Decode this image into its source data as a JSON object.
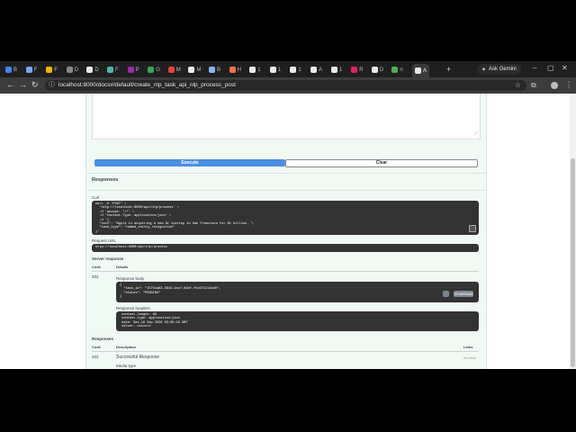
{
  "browser": {
    "tabs": [
      {
        "label": "B",
        "color": "#4285f4"
      },
      {
        "label": "F",
        "color": "#7aa7f7"
      },
      {
        "label": "F",
        "color": "#f4b400"
      },
      {
        "label": "D",
        "color": "#888888"
      },
      {
        "label": "D",
        "color": "#e8eaed"
      },
      {
        "label": "F",
        "color": "#4db6ac"
      },
      {
        "label": "P",
        "color": "#9c27b0"
      },
      {
        "label": "G",
        "color": "#34a853"
      },
      {
        "label": "M",
        "color": "#ea4335"
      },
      {
        "label": "M",
        "color": "#e8eaed"
      },
      {
        "label": "B",
        "color": "#8ab4f8"
      },
      {
        "label": "H",
        "color": "#ff7043"
      },
      {
        "label": "1",
        "color": "#e8eaed"
      },
      {
        "label": "1",
        "color": "#e8eaed"
      },
      {
        "label": "1",
        "color": "#e8eaed"
      },
      {
        "label": "A",
        "color": "#e8eaed"
      },
      {
        "label": "1",
        "color": "#e8eaed"
      },
      {
        "label": "R",
        "color": "#e91e63"
      },
      {
        "label": "D",
        "color": "#e8eaed"
      },
      {
        "label": "n",
        "color": "#4caf50"
      },
      {
        "label": "A",
        "color": "#e8eaed"
      }
    ],
    "new_tab": "+",
    "gemini_label": "Ask Gemini",
    "window_controls": [
      "–",
      "▢",
      "✕"
    ],
    "nav": {
      "back": "←",
      "forward": "→",
      "reload": "↻"
    },
    "url": "localhost:8000/docs#/default/create_nlp_task_api_nlp_process_post",
    "star": "☆",
    "right_icons": [
      "⋮"
    ]
  },
  "swagger": {
    "execute_label": "Execute",
    "clear_label": "Clear",
    "responses_heading": "Responses",
    "curl_label": "Curl",
    "curl_code": "curl -X 'POST' \\\n  'http://localhost:8000/api/nlp/process' \\\n  -H 'accept: */*' \\\n  -H 'Content-Type: application/json' \\\n  -d '{\n  \"text\": \"Apple is acquiring a new AI startup in San Francisco for $1 billion. \",\n  \"task_type\": \"named_entity_recognition\"\n}'",
    "request_url_label": "Request URL",
    "request_url": "http://localhost:8000/api/nlp/process",
    "server_response_label": "Server response",
    "code_header": "Code",
    "details_header": "Details",
    "status_code": "202",
    "response_body_label": "Response body",
    "response_body": "{\n  \"task_id\": \"1575ca83-3843-4ac7-89bf-f5c871112a40\",\n  \"status\": \"PENDING\"\n}",
    "download_label": "Download",
    "response_headers_label": "Response headers",
    "response_headers": " content-length: 69 \n content-type: application/json \n date: Sat,19 Sep 2026 03:05:19 GMT \n server: uvicorn ",
    "responses_label2": "Responses",
    "description_header": "Description",
    "links_header": "Links",
    "doc_code": "202",
    "doc_description": "Successful Response",
    "no_links": "No links",
    "media_type_label": "Media type"
  }
}
